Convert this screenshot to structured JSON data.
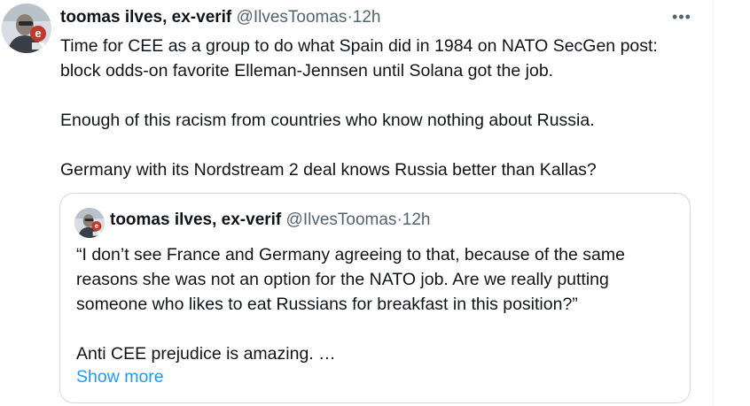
{
  "tweet": {
    "author_name": "toomas ilves, ex-verif",
    "handle": "@IlvesToomas",
    "separator": " · ",
    "time": "12h",
    "more_label": "•••",
    "paragraphs": [
      "Time for CEE as a group to do what Spain did in 1984 on NATO SecGen post: block odds-on favorite Elleman-Jennsen until Solana got the job.",
      "Enough of this racism from countries who know nothing about Russia.",
      "Germany with its Nordstream 2 deal knows Russia better than Kallas?"
    ]
  },
  "quoted_tweet": {
    "author_name": "toomas ilves, ex-verif",
    "handle": "@IlvesToomas",
    "separator": " · ",
    "time": "12h",
    "paragraphs": [
      "“I don’t see France and Germany agreeing to that, because of the same reasons she was not an option for the NATO job. Are we really putting someone who likes to eat Russians for breakfast in this position?”",
      "Anti CEE prejudice is amazing. …"
    ],
    "show_more_label": "Show more"
  },
  "avatar": {
    "icon": "profile-photo-with-e-badge",
    "colors": {
      "background": "#d8dde3",
      "badge": "#c0392b",
      "shirt": "#3a3f47"
    }
  }
}
